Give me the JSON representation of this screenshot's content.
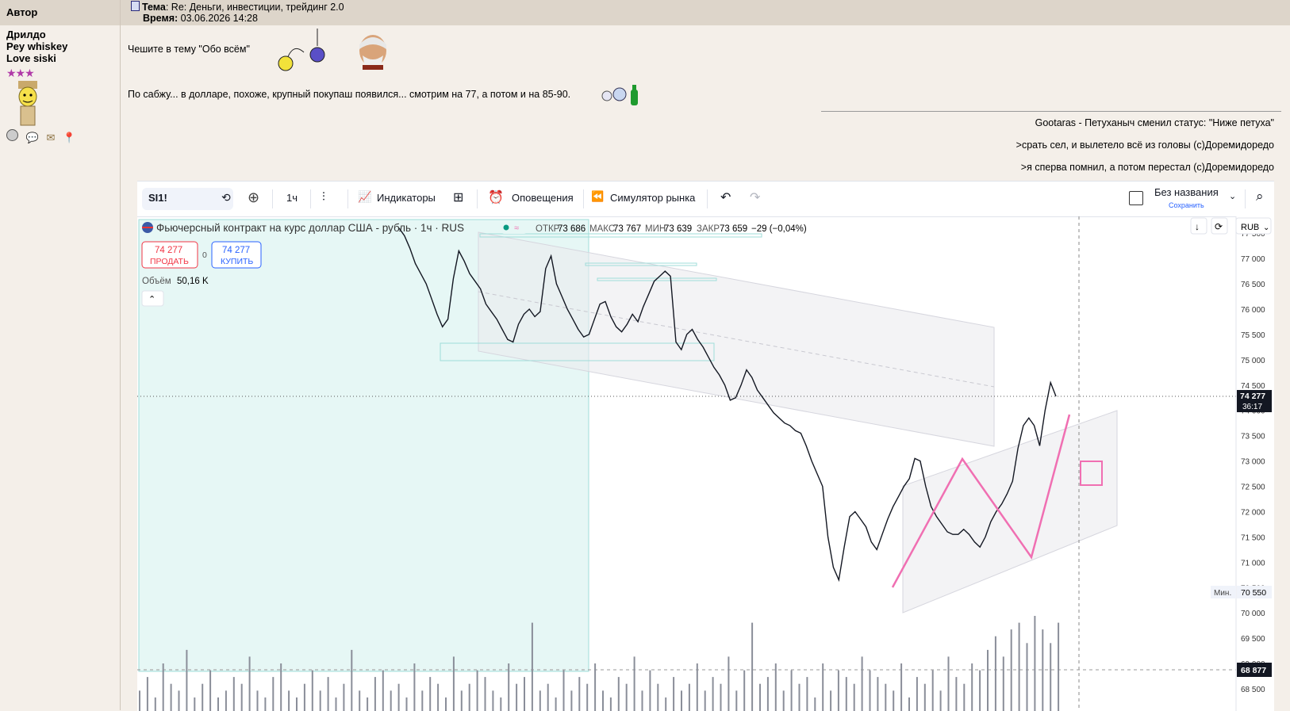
{
  "header": {
    "author_label": "Автор",
    "topic_prefix": "Тема",
    "topic_text": ": Re: Деньги, инвестиции, трейдинг 2.0",
    "time_prefix": "Время:",
    "time_value": " 03.06.2026 14:28"
  },
  "author": {
    "lines": [
      "Дрилдо",
      "Pey whiskey",
      "Love siski"
    ],
    "stars": "★★★"
  },
  "post": {
    "line1": "Чешите в тему \"Обо всём\"",
    "line2": "По сабжу... в долларе, похоже, крупный покупаш появился... смотрим на 77, а потом и на 85-90."
  },
  "signature": [
    "Gootaras - Петуханыч сменил статус: \"Ниже петуха\"",
    ">срать сел, и вылетело всё из головы (с)Доремидоредо",
    ">я сперва помнил, а потом перестал (с)Доремидоредо"
  ],
  "toolbar": {
    "symbol": "SI1!",
    "interval": "1ч",
    "indicators": "Индикаторы",
    "alerts": "Оповещения",
    "simulator": "Симулятор рынка",
    "layout_name": "Без названия",
    "save": "Сохранить"
  },
  "legend": {
    "title": "Фьючерсный контракт на курс доллар США - рубль · 1ч · RUS",
    "open_label": "ОТКР",
    "open": "73 686",
    "high_label": "МАКС",
    "high": "73 767",
    "low_label": "МИН",
    "low": "73 639",
    "close_label": "ЗАКР",
    "close": "73 659",
    "change": "−29 (−0,04%)",
    "sell_price": "74 277",
    "sell_label": "ПРОДАТЬ",
    "spread": "0",
    "buy_price": "74 277",
    "buy_label": "КУПИТЬ",
    "volume_label": "Объём",
    "volume": "50,16 K"
  },
  "price_axis": {
    "currency": "RUB",
    "current_price": "74 277",
    "countdown": "36:17",
    "min_label": "Мин.",
    "min_value": "70 550",
    "bottom_marker": "68 877"
  },
  "colors": {
    "up": "#131722",
    "bg": "#ffffff",
    "accent": "#2962ff",
    "sell": "#f23645",
    "pink": "#f06fb2",
    "cyan_zone": "#e6f7f5"
  },
  "chart_data": {
    "type": "line",
    "series": [
      {
        "values": [
          77600,
          77450,
          77200,
          76900,
          76700,
          76500,
          76200,
          75900,
          75650,
          75800,
          76600,
          77150,
          76950,
          76700,
          76550,
          76400,
          76100,
          75950,
          75800,
          75600,
          75400,
          75350,
          75700,
          75900,
          76000,
          75850,
          75950,
          76800,
          77050,
          76500,
          76250,
          76000,
          75800,
          75600,
          75450,
          75500,
          75800,
          76100,
          76150,
          75850,
          75650,
          75550,
          75700,
          75900,
          75750,
          76050,
          76300,
          76550,
          76650,
          76750,
          76650,
          75350,
          75200,
          75500,
          75600,
          75400,
          75250,
          75050,
          74850,
          74700,
          74500,
          74200,
          74250,
          74500,
          74800,
          74650,
          74400,
          74250,
          74100,
          73950,
          73850,
          73750,
          73700,
          73600,
          73550,
          73300,
          73000,
          72750,
          72500,
          71500,
          70900,
          70650,
          71300,
          71900,
          72000,
          71850,
          71700,
          71400,
          71250,
          71550,
          71850,
          72100,
          72300,
          72500,
          72650,
          73050,
          73000,
          72500,
          72100,
          71900,
          71750,
          71600,
          71550,
          71550,
          71650,
          71550,
          71400,
          71300,
          71500,
          71800,
          72000,
          72150,
          72350,
          72600,
          73250,
          73700,
          73850,
          73700,
          73300,
          74000,
          74550,
          74277
        ]
      }
    ],
    "xlabel": "",
    "ylabel": "",
    "ylim": [
      68500,
      77800
    ],
    "y_ticks": [
      "77 500",
      "77 000",
      "76 500",
      "76 000",
      "75 500",
      "75 000",
      "74 500",
      "74 000",
      "73 500",
      "73 000",
      "72 500",
      "72 000",
      "71 500",
      "71 000",
      "70 500",
      "70 000",
      "69 500",
      "69 000",
      "68 500"
    ],
    "volumes": [
      3,
      5,
      2,
      7,
      4,
      3,
      9,
      2,
      4,
      6,
      2,
      3,
      5,
      4,
      8,
      3,
      2,
      5,
      7,
      3,
      2,
      4,
      6,
      3,
      5,
      2,
      4,
      9,
      3,
      2,
      5,
      6,
      3,
      4,
      2,
      7,
      3,
      5,
      4,
      2,
      8,
      3,
      4,
      6,
      5,
      3,
      2,
      7,
      4,
      5,
      13,
      3,
      4,
      2,
      6,
      3,
      5,
      4,
      7,
      3,
      2,
      5,
      4,
      8,
      3,
      6,
      4,
      2,
      5,
      3,
      4,
      7,
      3,
      5,
      4,
      8,
      3,
      6,
      13,
      4,
      5,
      7,
      3,
      6,
      4,
      5,
      2,
      7,
      3,
      6,
      5,
      4,
      8,
      6,
      5,
      4,
      3,
      7,
      2,
      5,
      4,
      6,
      3,
      8,
      5,
      4,
      7,
      6,
      9,
      11,
      8,
      12,
      13,
      10,
      14,
      12,
      10,
      13
    ]
  }
}
